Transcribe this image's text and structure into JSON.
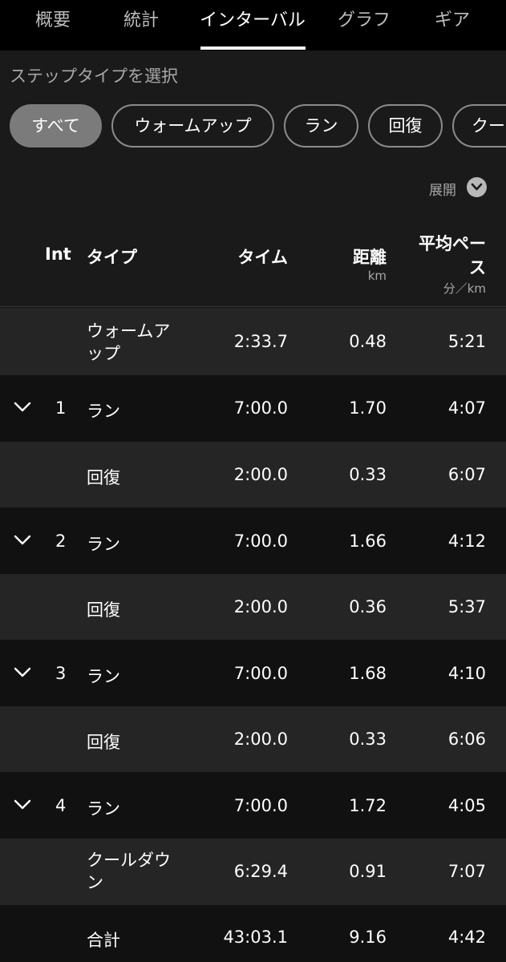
{
  "tabs": [
    {
      "label": "概要"
    },
    {
      "label": "統計"
    },
    {
      "label": "インターバル"
    },
    {
      "label": "グラフ"
    },
    {
      "label": "ギア"
    }
  ],
  "filter": {
    "title": "ステップタイプを選択",
    "chips": [
      "すべて",
      "ウォームアップ",
      "ラン",
      "回復",
      "クー"
    ],
    "expand_label": "展開"
  },
  "table": {
    "headers": {
      "int": "Int",
      "type": "タイプ",
      "time": "タイム",
      "distance": "距離",
      "distance_unit": "km",
      "pace": "平均ペース",
      "pace_unit": "分／km"
    },
    "rows": [
      {
        "int": "",
        "type": "ウォームアップ",
        "type_line1": "ウォームア",
        "type_line2": "ップ",
        "time": "2:33.7",
        "distance": "0.48",
        "pace": "5:21"
      },
      {
        "int": "1",
        "type": "ラン",
        "time": "7:00.0",
        "distance": "1.70",
        "pace": "4:07"
      },
      {
        "int": "",
        "type": "回復",
        "time": "2:00.0",
        "distance": "0.33",
        "pace": "6:07"
      },
      {
        "int": "2",
        "type": "ラン",
        "time": "7:00.0",
        "distance": "1.66",
        "pace": "4:12"
      },
      {
        "int": "",
        "type": "回復",
        "time": "2:00.0",
        "distance": "0.36",
        "pace": "5:37"
      },
      {
        "int": "3",
        "type": "ラン",
        "time": "7:00.0",
        "distance": "1.68",
        "pace": "4:10"
      },
      {
        "int": "",
        "type": "回復",
        "time": "2:00.0",
        "distance": "0.33",
        "pace": "6:06"
      },
      {
        "int": "4",
        "type": "ラン",
        "time": "7:00.0",
        "distance": "1.72",
        "pace": "4:05"
      },
      {
        "int": "",
        "type": "クールダウン",
        "type_line1": "クールダウ",
        "type_line2": "ン",
        "time": "6:29.4",
        "distance": "0.91",
        "pace": "7:07"
      },
      {
        "int": "",
        "type": "合計",
        "time": "43:03.1",
        "distance": "9.16",
        "pace": "4:42"
      }
    ]
  }
}
